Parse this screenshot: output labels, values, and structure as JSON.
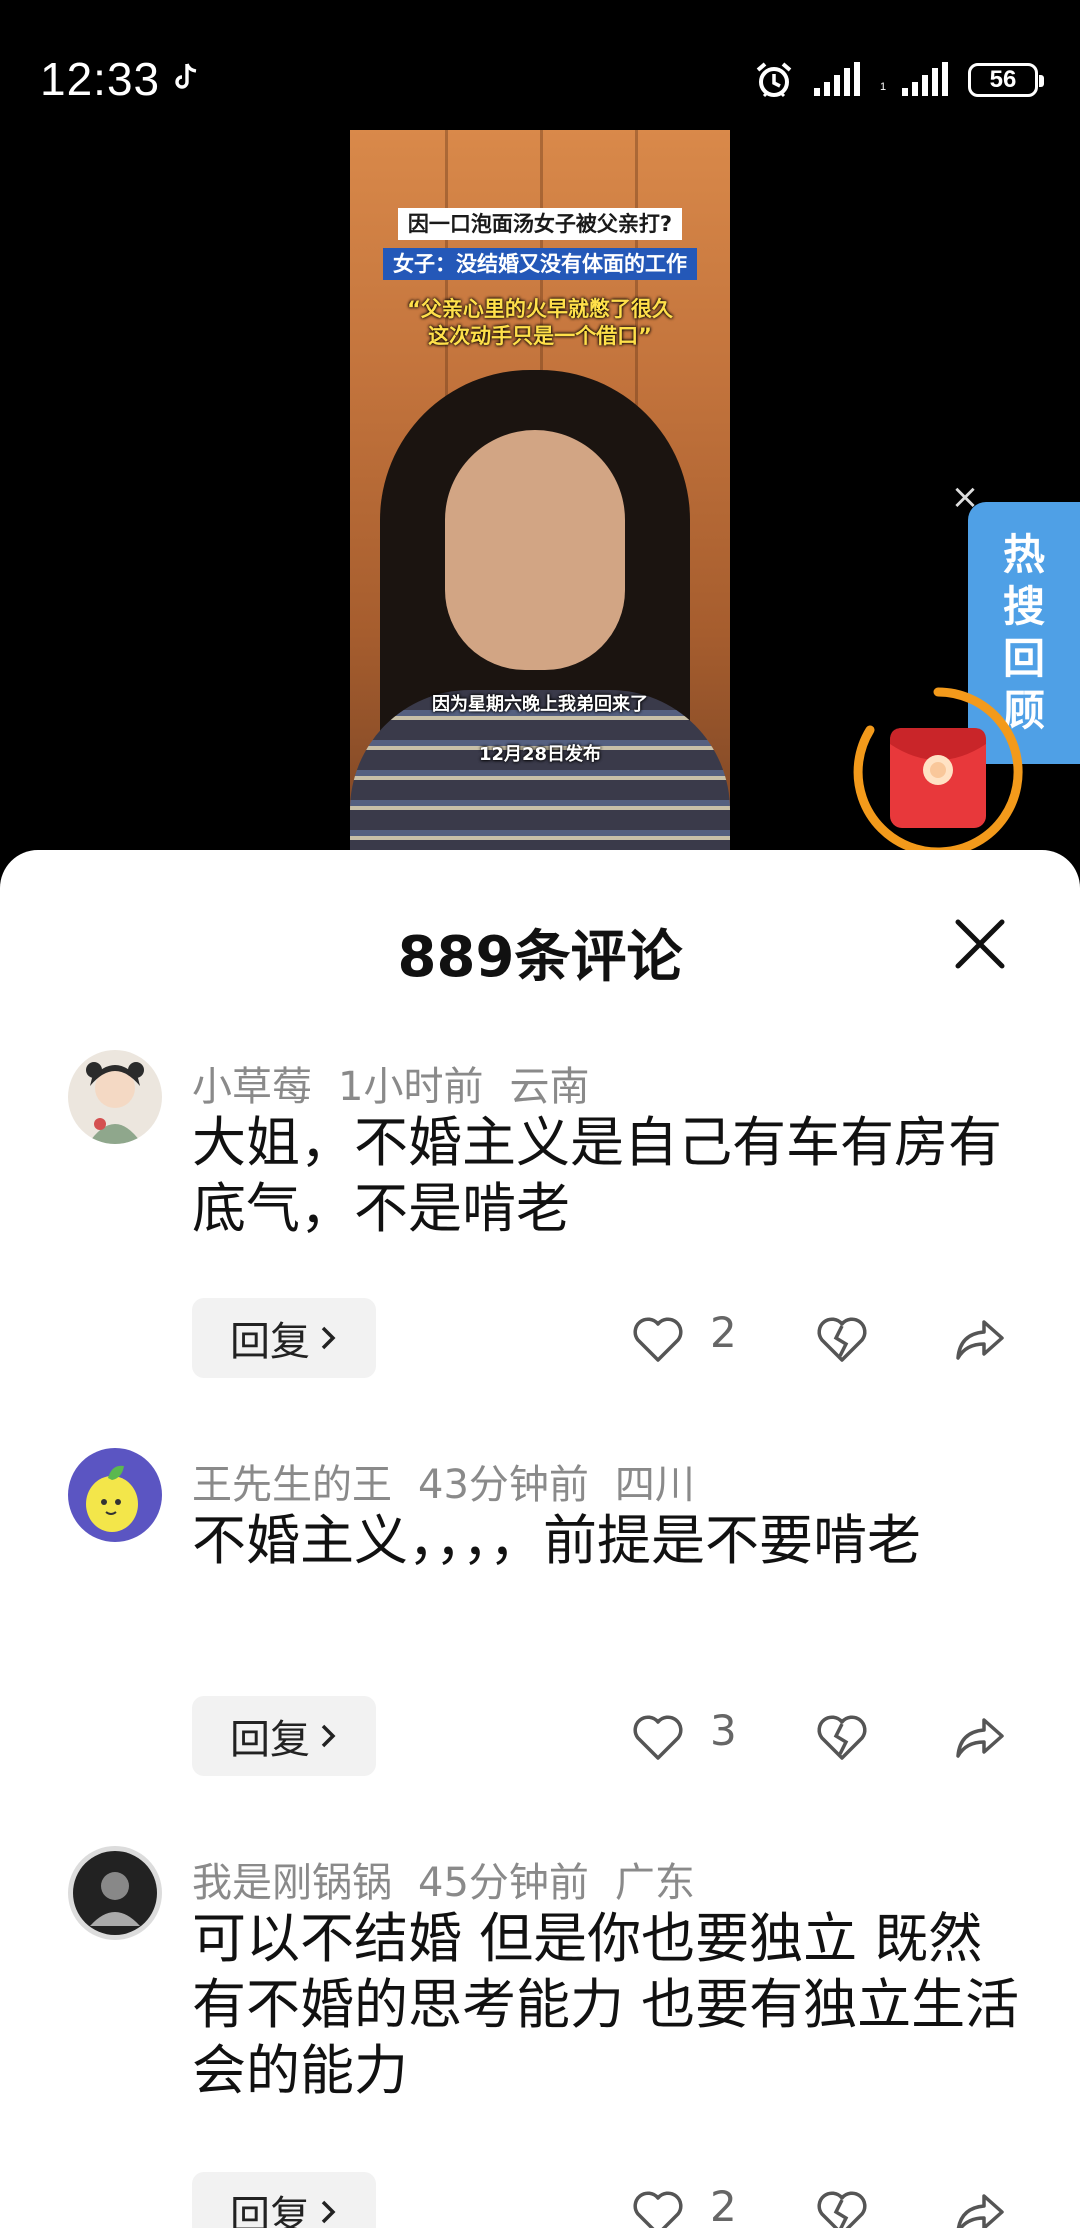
{
  "status_bar": {
    "time": "12:33",
    "battery": "56",
    "icons": [
      "tiktok-icon",
      "alarm-icon",
      "signal-icon",
      "signal-icon",
      "battery-icon"
    ]
  },
  "video": {
    "caption_title": "因一口泡面汤女子被父亲打?",
    "caption_sub": "女子：没结婚又没有体面的工作",
    "caption_quote_line1": "“父亲心里的火早就憋了很久",
    "caption_quote_line2": "这次动手只是一个借口”",
    "subtitle": "因为星期六晚上我弟回来了",
    "publish_date": "12月28日发布"
  },
  "hot_search_tab": {
    "chars": [
      "热",
      "搜",
      "回",
      "顾"
    ],
    "color": "#4fa0e6"
  },
  "comments_sheet": {
    "title": "889条评论",
    "reply_label": "回复",
    "comments": [
      {
        "user": "小草莓",
        "time": "1小时前",
        "location": "云南",
        "text": "大姐，不婚主义是自己有车有房有底气，不是啃老",
        "likes": "2"
      },
      {
        "user": "王先生的王",
        "time": "43分钟前",
        "location": "四川",
        "text": "不婚主义，，，，前提是不要啃老",
        "likes": "3"
      },
      {
        "user": "我是刚锅锅",
        "time": "45分钟前",
        "location": "广东",
        "text": "可以不结婚 但是你也要独立 既然有不婚的思考能力 也要有独立生活会的能力",
        "likes": "2"
      }
    ]
  }
}
